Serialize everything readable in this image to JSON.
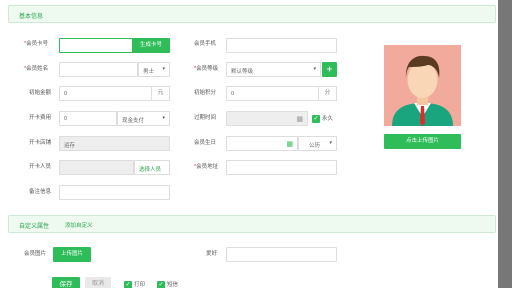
{
  "section_basic": {
    "title": "基本信息"
  },
  "fields": {
    "card_no": {
      "label": "会员卡号",
      "value": "",
      "gen_btn": "生成卡号"
    },
    "phone": {
      "label": "会员手机",
      "value": ""
    },
    "name": {
      "label": "会员姓名",
      "value": "",
      "gender": "男士"
    },
    "level": {
      "label": "会员等级",
      "value": "默认等级",
      "add": "+"
    },
    "init_amount": {
      "label": "初始金额",
      "value": "0",
      "unit": "元"
    },
    "init_points": {
      "label": "初始积分",
      "value": "0",
      "unit": "分"
    },
    "open_fee": {
      "label": "开卡费用",
      "value": "0",
      "pay": "现金支付"
    },
    "expire": {
      "label": "过期时间",
      "value": "",
      "forever": "永久"
    },
    "open_store": {
      "label": "开卡店铺",
      "value": "运存"
    },
    "birthday": {
      "label": "会员生日",
      "value": "",
      "calendar": "公历"
    },
    "open_staff": {
      "label": "开卡人员",
      "value": "",
      "select": "选择人员"
    },
    "address": {
      "label": "会员地址",
      "value": ""
    },
    "remark": {
      "label": "备注信息",
      "value": ""
    }
  },
  "avatar": {
    "upload_btn": "点击上传图片"
  },
  "section_custom": {
    "title": "自定义属性",
    "add_link": "添加自定义"
  },
  "custom": {
    "member_pic": {
      "label": "会员图片",
      "btn": "上传图片"
    },
    "hobby": {
      "label": "爱好",
      "value": ""
    }
  },
  "footer": {
    "save": "保存",
    "cancel": "取消",
    "print": "打印",
    "sms": "短信"
  },
  "colors": {
    "accent": "#2ebd59",
    "section_bg": "#eef9f0",
    "avatar_bg": "#f1aa9c"
  }
}
